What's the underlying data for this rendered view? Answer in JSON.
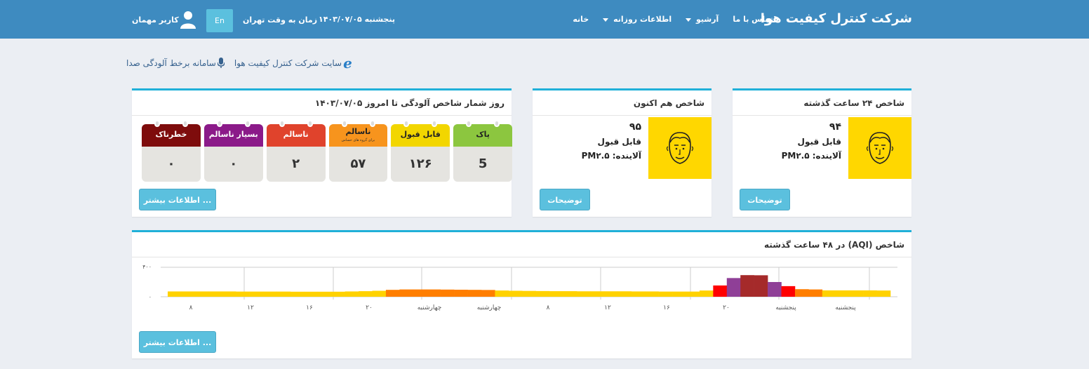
{
  "header": {
    "brand": "شرکت کنترل کیفیت هوا",
    "nav": {
      "home": "خانه",
      "daily": "اطلاعات روزانه",
      "archive": "آرشیو",
      "contact": "تماس با ما"
    },
    "date": "پنجشنبه ۱۴۰۳/۰۷/۰۵",
    "timezone": "زمان به وقت تهران",
    "lang_button": "En",
    "user": "کاربر مهمان"
  },
  "links": {
    "company_site": "سایت شرکت کنترل کیفیت هوا",
    "voice_system": "سامانه برخط آلودگی صدا"
  },
  "card24": {
    "title": "شاخص ۲۴ ساعت گذشته",
    "value": "۹۴",
    "category": "قابل قبول",
    "pollutant": "آلاینده: PM۲.۵",
    "button": "توضیحات"
  },
  "cardNow": {
    "title": "شاخص هم اکنون",
    "value": "۹۵",
    "category": "قابل قبول",
    "pollutant": "آلاینده: PM۲.۵",
    "button": "توضیحات"
  },
  "counter": {
    "title": "روز شمار شاخص آلودگی تا امروز ۱۴۰۳/۰۷/۰۵",
    "button": "اطلاعات بیشتر ...",
    "items": [
      {
        "label": "پاک",
        "sub": "",
        "count": "5",
        "color": "#8cc63f"
      },
      {
        "label": "قابل قبول",
        "sub": "",
        "count": "۱۲۶",
        "color": "#f2d600"
      },
      {
        "label": "ناسالم",
        "sub": "برای گروه های حساس",
        "count": "۵۷",
        "color": "#f7941d"
      },
      {
        "label": "ناسالم",
        "sub": "",
        "count": "۲",
        "color": "#e0432c"
      },
      {
        "label": "بسیار ناسالم",
        "sub": "",
        "count": "۰",
        "color": "#8b1a89"
      },
      {
        "label": "خطرناک",
        "sub": "",
        "count": "۰",
        "color": "#7e0c0c"
      }
    ]
  },
  "chart_card": {
    "title": "شاخص (AQI) در ۴۸ ساعت گذشته",
    "button": "اطلاعات بیشتر ..."
  },
  "chart_data": {
    "type": "bar",
    "ylim": [
      0,
      400
    ],
    "yticks": [
      "۴۰۰",
      "۰"
    ],
    "x_tick_labels": [
      "۸",
      "۱۲",
      "۱۶",
      "۲۰",
      "چهارشنبه",
      "چهارشنبه",
      "۸",
      "۱۲",
      "۱۶",
      "۲۰",
      "پنجشنبه",
      "پنجشنبه"
    ],
    "values": [
      80,
      80,
      80,
      80,
      80,
      78,
      78,
      78,
      78,
      76,
      76,
      76,
      76,
      80,
      84,
      90,
      104,
      110,
      110,
      110,
      108,
      106,
      104,
      102,
      94,
      90,
      88,
      86,
      84,
      84,
      82,
      82,
      82,
      82,
      80,
      80,
      78,
      78,
      78,
      94,
      170,
      282,
      326,
      324,
      222,
      160,
      114,
      110,
      96,
      96,
      96,
      96,
      94
    ],
    "colors": {
      "good": "#00e400",
      "moderate": "#ffd200",
      "usg": "#ff7e00",
      "unhealthy": "#ff0000",
      "very_unhealthy": "#8f3f97",
      "hazardous": "#a52a2a"
    }
  }
}
